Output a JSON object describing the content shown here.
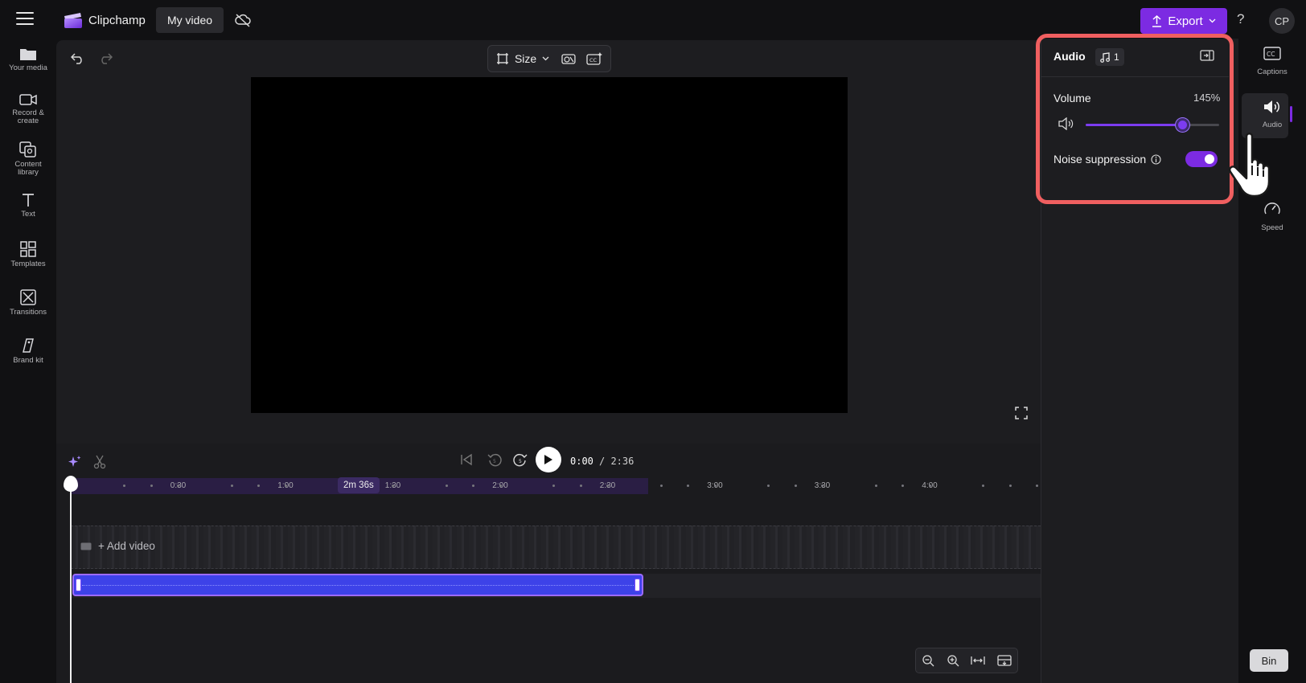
{
  "topbar": {
    "app_name": "Clipchamp",
    "project_name": "My video",
    "export_label": "Export",
    "help_label": "?",
    "avatar_initials": "CP"
  },
  "left_rail": {
    "items": [
      {
        "label": "Your media",
        "icon": "folder-icon"
      },
      {
        "label": "Record &\ncreate",
        "icon": "camera-icon"
      },
      {
        "label": "Content\nlibrary",
        "icon": "library-icon"
      },
      {
        "label": "Text",
        "icon": "text-icon"
      },
      {
        "label": "Templates",
        "icon": "templates-icon"
      },
      {
        "label": "Transitions",
        "icon": "transitions-icon"
      },
      {
        "label": "Brand kit",
        "icon": "brand-kit-icon"
      }
    ]
  },
  "toolbar": {
    "size_label": "Size"
  },
  "playback": {
    "current_time": "0:00",
    "total_time": "/ 2:36"
  },
  "timeline": {
    "ruler_labels": [
      "0:30",
      "1:00",
      "1:30",
      "2:00",
      "2:30",
      "3:00",
      "3:30",
      "4:00"
    ],
    "duration_badge": "2m 36s",
    "add_video_label": "+ Add video"
  },
  "audio_panel": {
    "title": "Audio",
    "track_count": "1",
    "volume_label": "Volume",
    "volume_value": "145%",
    "volume_level_fraction": 0.72,
    "noise_suppression_label": "Noise suppression",
    "noise_suppression_on": true
  },
  "right_rail": {
    "items": [
      {
        "label": "Captions",
        "icon": "captions-icon"
      },
      {
        "label": "Audio",
        "icon": "speaker-icon",
        "active": true
      },
      {
        "label": "Speed",
        "icon": "speed-icon"
      }
    ]
  },
  "bin_label": "Bin",
  "colors": {
    "accent": "#7c2be2",
    "highlight_outline": "#f05f60",
    "audio_clip": "#3d42e8"
  }
}
